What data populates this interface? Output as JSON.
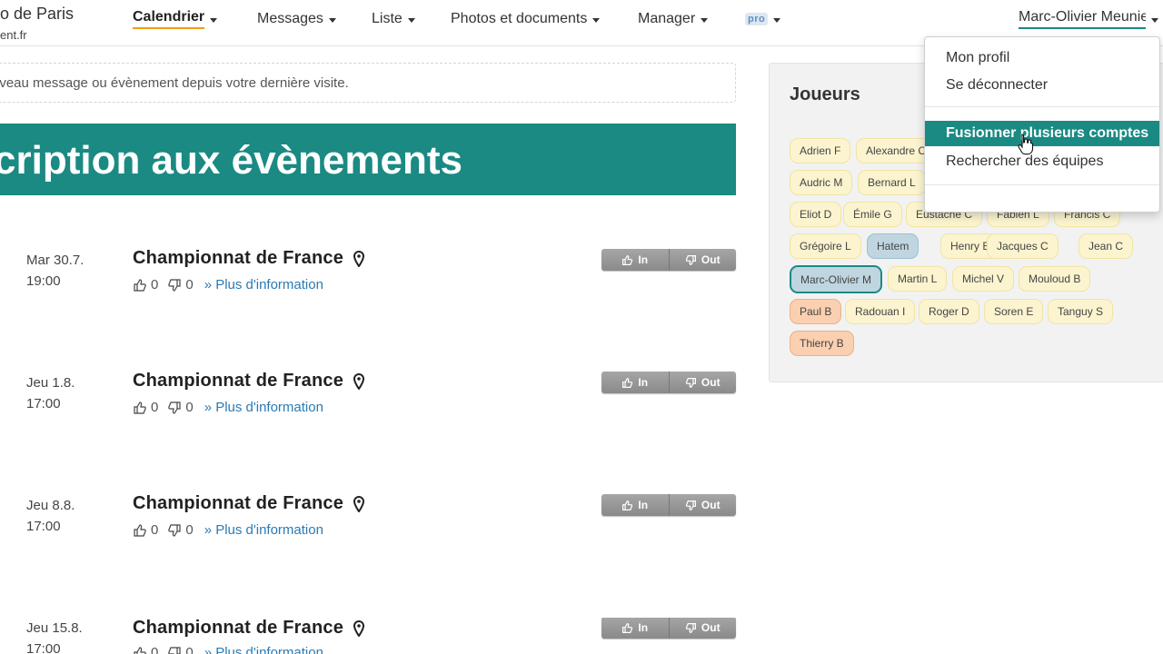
{
  "brand": {
    "name": "o de Paris",
    "domain": "ent.fr"
  },
  "nav": {
    "items": [
      {
        "label": "Calendrier"
      },
      {
        "label": "Messages"
      },
      {
        "label": "Liste"
      },
      {
        "label": "Photos et documents"
      },
      {
        "label": "Manager"
      }
    ],
    "pro_label": "pro",
    "user_name": "Marc-Olivier Meunier"
  },
  "notice": "uveau message ou évènement depuis votre dernière visite.",
  "banner_title": "cription aux évènements",
  "events": [
    {
      "date": "Mar 30.7.",
      "time": "19:00",
      "title": "Championnat de France",
      "likes": "0",
      "dislikes": "0",
      "more": "» Plus d'information",
      "in_label": "In",
      "out_label": "Out"
    },
    {
      "date": "Jeu 1.8.",
      "time": "17:00",
      "title": "Championnat de France",
      "likes": "0",
      "dislikes": "0",
      "more": "» Plus d'information",
      "in_label": "In",
      "out_label": "Out"
    },
    {
      "date": "Jeu 8.8.",
      "time": "17:00",
      "title": "Championnat de France",
      "likes": "0",
      "dislikes": "0",
      "more": "» Plus d'information",
      "in_label": "In",
      "out_label": "Out"
    },
    {
      "date": "Jeu 15.8.",
      "time": "17:00",
      "title": "Championnat de France",
      "likes": "0",
      "dislikes": "0",
      "more": "» Plus d'information",
      "in_label": "In",
      "out_label": "Out"
    }
  ],
  "players": {
    "title": "Joueurs",
    "chips": [
      "Adrien F",
      "Alexandre C",
      "Audric M",
      "Bernard L",
      "Eliot D",
      "Émile G",
      "Eustache C",
      "Fabien L",
      "Francis C",
      "Grégoire L",
      "Hatem",
      "Henry B",
      "Jacques C",
      "Jean C",
      "Marc-Olivier M",
      "Martin L",
      "Michel V",
      "Mouloud B",
      "Paul B",
      "Radouan I",
      "Roger D",
      "Soren E",
      "Tanguy S",
      "Thierry B"
    ]
  },
  "dropdown": {
    "items": [
      {
        "label": "Mon profil"
      },
      {
        "label": "Se déconnecter"
      },
      {
        "label": "Fusionner plusieurs comptes"
      },
      {
        "label": "Rechercher des équipes"
      }
    ]
  },
  "colors": {
    "accent": "#1a8a83",
    "active_underline": "#f39c12",
    "link": "#2a7ab5"
  }
}
